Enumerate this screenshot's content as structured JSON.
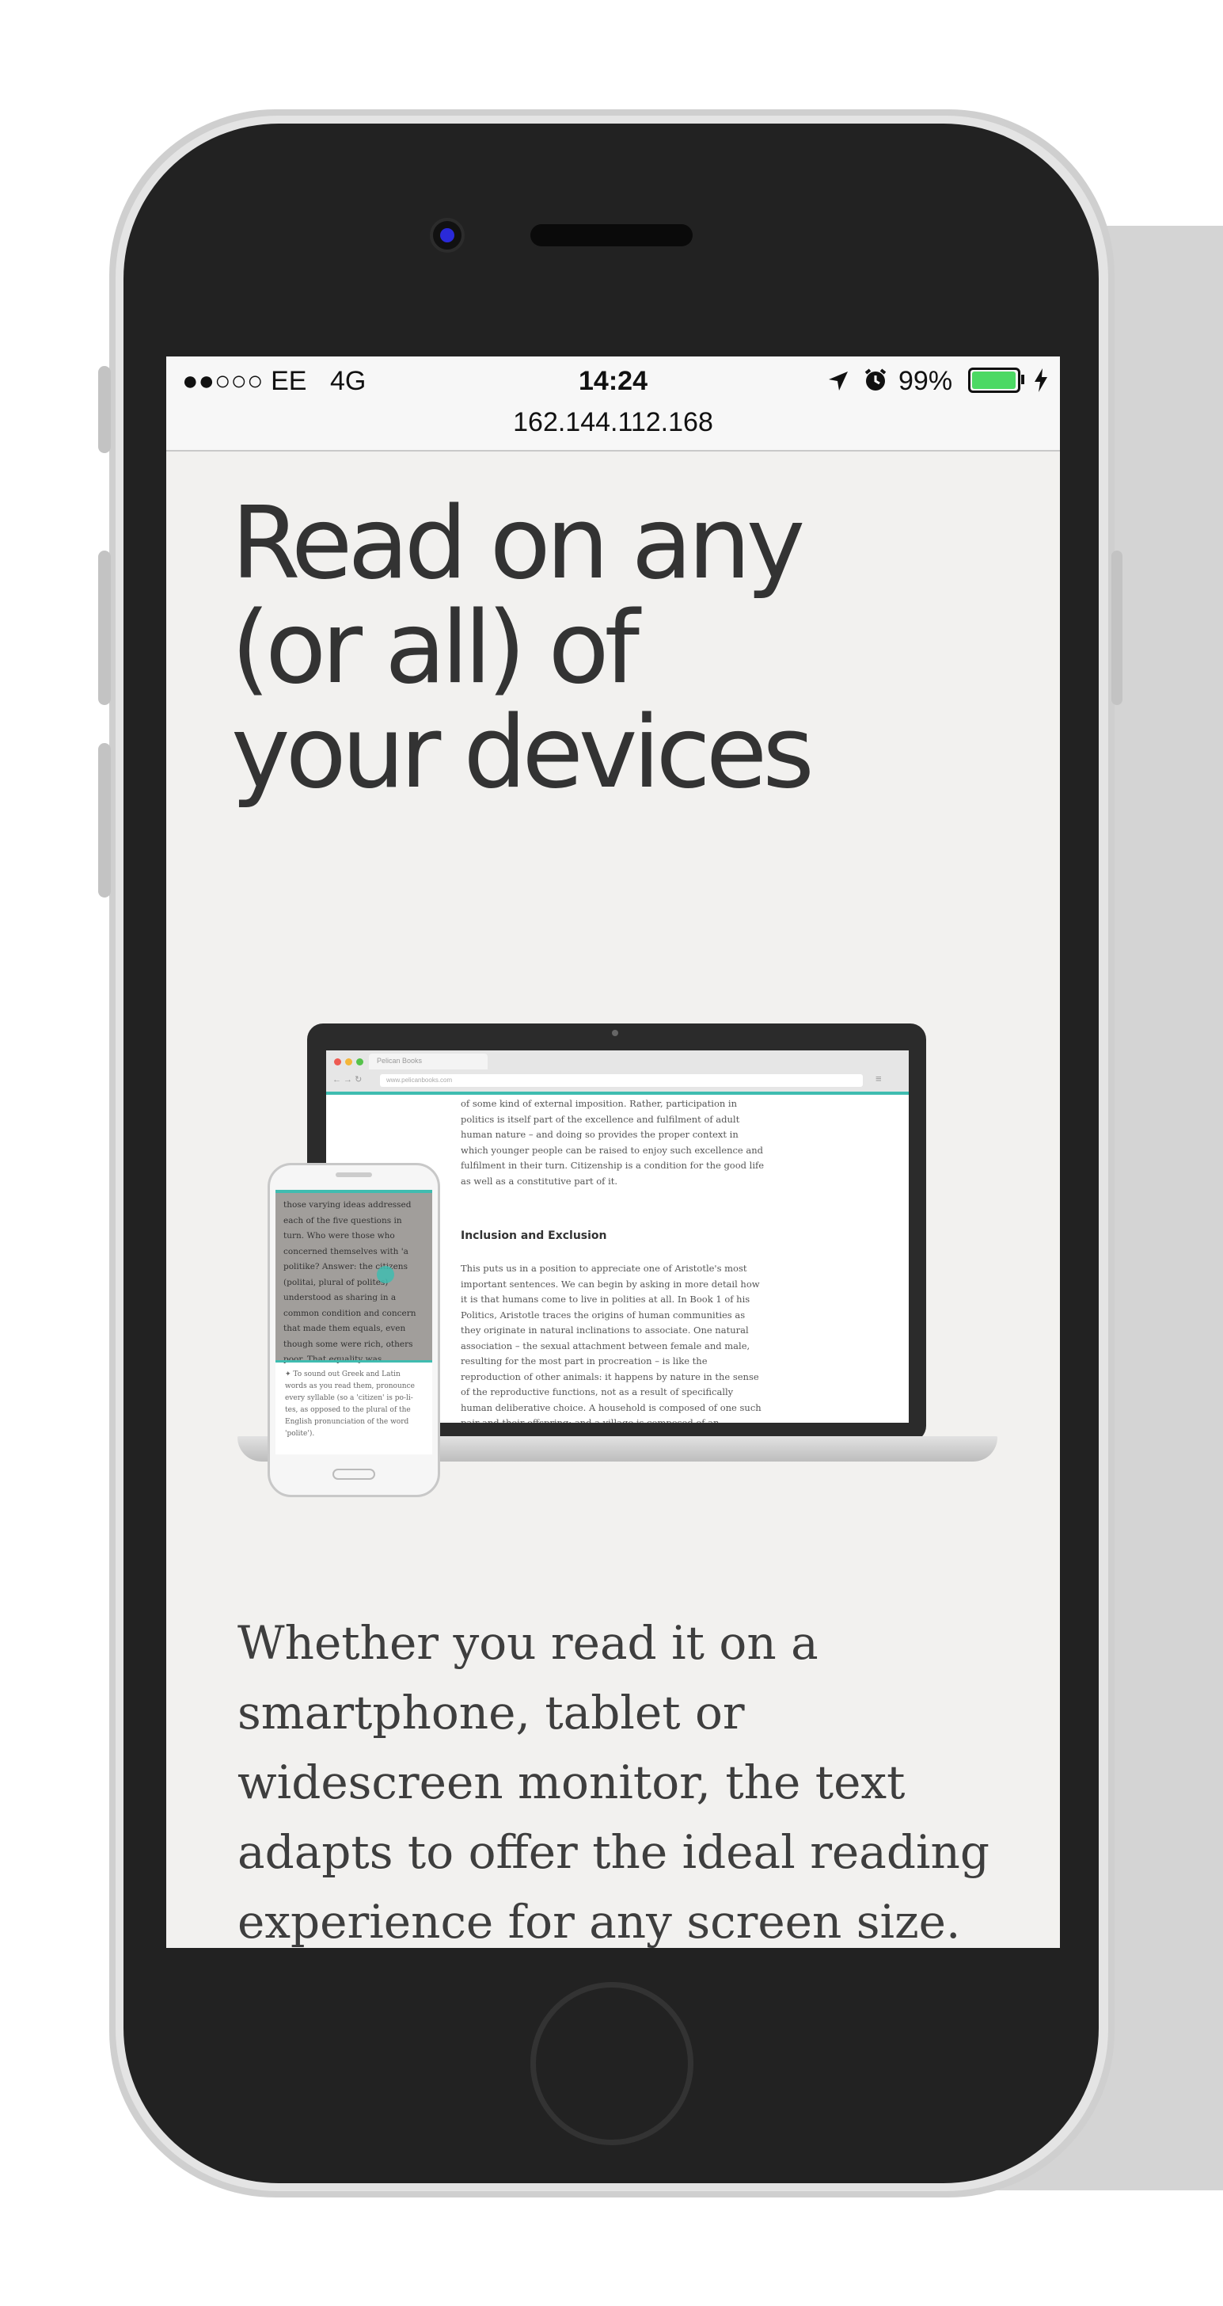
{
  "status_bar": {
    "carrier": "●●○○○ EE",
    "network": "4G",
    "time": "14:24",
    "battery_percent": "99%",
    "battery_level": 0.99,
    "url": "162.144.112.168"
  },
  "hero": {
    "headline_lines": [
      "Read on any",
      "(or all) of",
      "your devices"
    ]
  },
  "illustration": {
    "browser_tab": "Pelican Books",
    "browser_url": "www.pelicanbooks.com",
    "laptop_para1": "of some kind of external imposition. Rather, participation in politics is itself part of the excellence and fulfilment of adult human nature – and doing so provides the proper context in which younger people can be raised to enjoy such excellence and fulfilment in their turn. Citizenship is a condition for the good life as well as a constitutive part of it.",
    "laptop_heading": "Inclusion and Exclusion",
    "laptop_para2": "This puts us in a position to appreciate one of Aristotle's most important sentences. We can begin by asking in more detail how it is that humans come to live in polities at all. In Book 1 of his Politics, Aristotle traces the origins of human communities as they originate in natural inclinations to associate. One natural association – the sexual attachment between female and male, resulting for the most part in procreation – is like the reproduction of other animals: it happens by nature in the sense of the reproductive functions, not as a result of specifically human deliberative choice. A household is composed of one such pair and their offspring; and a village is composed of an agglomeration of households, perhaps originally bound by kinship ties, as the brothers of a family establish households of",
    "phone_text": "those varying ideas addressed each of the five questions in turn. Who were those who concerned themselves with 'a politike? Answer: the citizens (politai, plural of polites) understood as sharing in a common condition and concern that made them equals, even though some were rich, others poor. That equality was",
    "phone_note": "✦ To sound out Greek and Latin words as you read them, pronounce every syllable (so a 'citizen' is po-li-tes, as opposed to the plural of the English pronunciation of the word 'polite')."
  },
  "body": {
    "text": "Whether you read it on a smartphone, tablet or widescreen monitor, the text adapts to offer the ideal reading experience for any screen size."
  },
  "colors": {
    "accent": "#3fbcb0",
    "battery_green": "#4cd964",
    "headline": "#333333",
    "screen_bg": "#f2f1ef",
    "phone_body": "#222222"
  }
}
